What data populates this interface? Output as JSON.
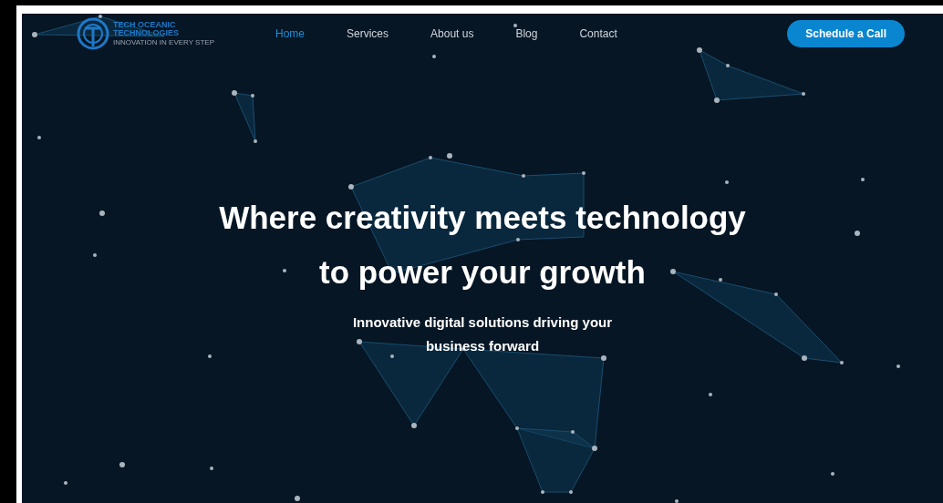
{
  "logo": {
    "line_1": "TECH OCEANIC",
    "line_2": "TECHNOLOGIES",
    "tagline": "INNOVATION IN EVERY STEP"
  },
  "nav": [
    {
      "label": "Home",
      "selected": true
    },
    {
      "label": "Services",
      "selected": false
    },
    {
      "label": "About us",
      "selected": false
    },
    {
      "label": "Blog",
      "selected": false
    },
    {
      "label": "Contact",
      "selected": false
    }
  ],
  "cta": "Schedule a Call",
  "hero": {
    "title_line_1": "Where creativity meets technology",
    "title_line_2": "to power your growth",
    "subtitle_line_1": "Innovative digital solutions driving your",
    "subtitle_line_2": "business forward"
  }
}
